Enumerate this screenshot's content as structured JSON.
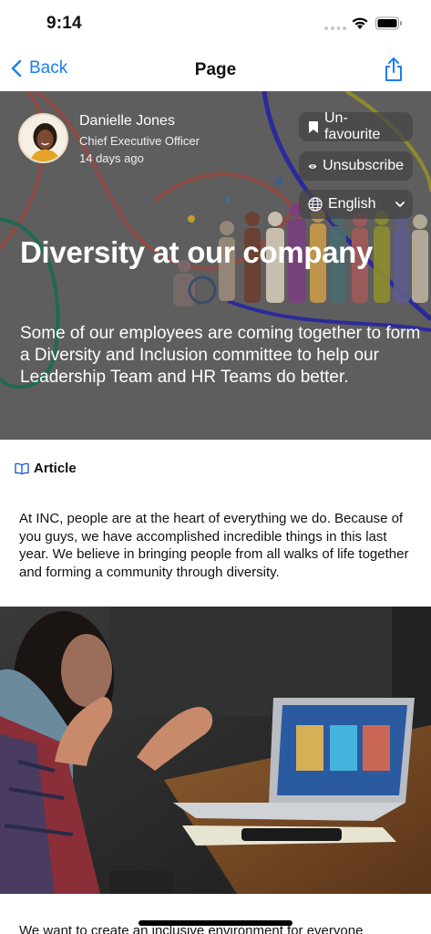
{
  "status_bar": {
    "time": "9:14"
  },
  "nav": {
    "back_label": "Back",
    "title": "Page"
  },
  "hero": {
    "author": {
      "name": "Danielle Jones",
      "role": "Chief Executive Officer",
      "time": "14 days ago"
    },
    "actions": {
      "favourite_label": "Un-favourite",
      "unsubscribe_label": "Unsubscribe",
      "language_label": "English"
    },
    "title": "Diversity at our company",
    "description": "Some of our employees are coming together to form a Diversity and Inclusion committee to help our Leadership Team and HR Teams do better."
  },
  "article": {
    "label": "Article",
    "body": "At INC, people are at the heart of everything we do. Because of you guys, we have accomplished incredible things in this last year. We believe in bringing people from all walks of life together and forming a community through diversity.",
    "continued_text": "We want to create an inclusive environment for everyone"
  },
  "colors": {
    "accent": "#1a7ef2",
    "hero_overlay": "#5d5d5d",
    "pill_bg": "#464646"
  },
  "icons": {
    "back": "chevron-left-icon",
    "share": "share-icon",
    "favourite": "bookmark-icon",
    "unsubscribe": "eye-icon",
    "language": "globe-icon",
    "article": "book-icon"
  }
}
